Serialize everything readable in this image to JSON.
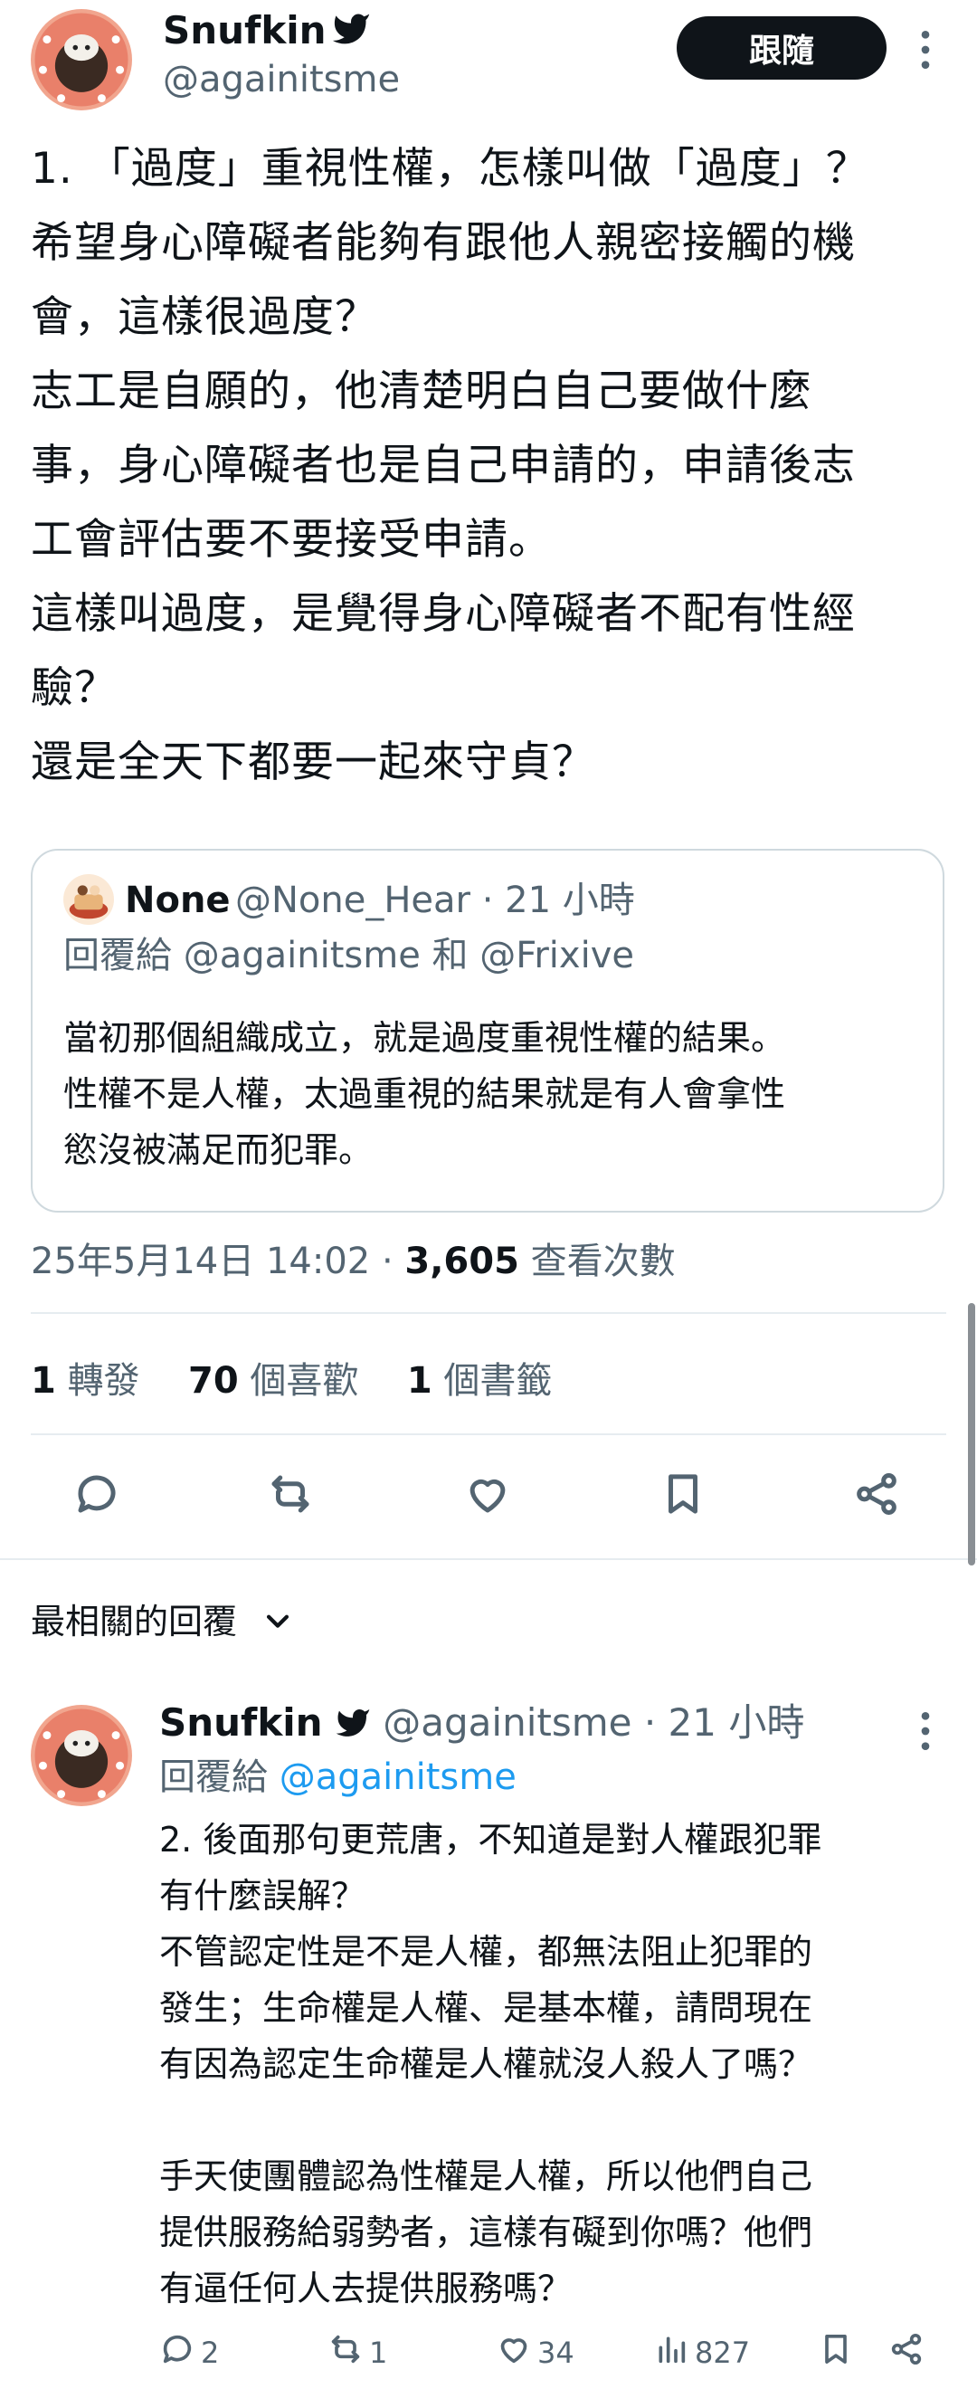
{
  "tweet": {
    "display_name": "Snufkin",
    "handle": "@againitsme",
    "follow_label": "跟隨",
    "paragraphs": [
      "1. 「過度」重視性權，怎樣叫做「過度」？",
      "希望身心障礙者能夠有跟他人親密接觸的機",
      "會，這樣很過度？",
      "志工是自願的，他清楚明白自己要做什麼",
      "事，身心障礙者也是自己申請的，申請後志",
      "工會評估要不要接受申請。",
      "這樣叫過度，是覺得身心障礙者不配有性經",
      "驗？",
      "還是全天下都要一起來守貞？"
    ],
    "timestamp": "25年5月14日 14:02",
    "views_count": "3,605",
    "views_label": "查看次數",
    "stats": {
      "retweets_count": "1",
      "retweets_label": "轉發",
      "likes_count": "70",
      "likes_label": "個喜歡",
      "bookmarks_count": "1",
      "bookmarks_label": "個書籤"
    }
  },
  "quoted": {
    "display_name": "None",
    "handle": "@None_Hear",
    "time": "· 21 小時",
    "reply_prefix": "回覆給",
    "reply_to_1": "@againitsme",
    "reply_join": "和",
    "reply_to_2": "@Frixive",
    "lines": [
      "當初那個組織成立，就是過度重視性權的結果。",
      "性權不是人權，太過重視的結果就是有人會拿性",
      "慾沒被滿足而犯罪。"
    ]
  },
  "replies_header": {
    "label": "最相關的回覆"
  },
  "reply": {
    "display_name": "Snufkin",
    "handle": "@againitsme",
    "time": "· 21 小時",
    "reply_prefix": "回覆給",
    "reply_to": "@againitsme",
    "lines": [
      "2. 後面那句更荒唐，不知道是對人權跟犯罪",
      "有什麼誤解？",
      "不管認定性是不是人權，都無法阻止犯罪的",
      "發生；生命權是人權、是基本權，請問現在",
      "有因為認定生命權是人權就沒人殺人了嗎？",
      "",
      "手天使團體認為性權是人權，所以他們自己",
      "提供服務給弱勢者，這樣有礙到你嗎？他們",
      "有逼任何人去提供服務嗎？"
    ],
    "actions": {
      "replies": "2",
      "retweets": "1",
      "likes": "34",
      "views": "827"
    }
  },
  "colors": {
    "text": "#0f1419",
    "secondary": "#536471",
    "link": "#1d9bf0",
    "border": "#cfd9de",
    "follow_bg": "#0f1419"
  },
  "icons": [
    "verified-badge-icon",
    "more-icon",
    "reply-icon",
    "retweet-icon",
    "like-icon",
    "bookmark-icon",
    "share-icon",
    "chevron-down-icon",
    "views-icon"
  ]
}
